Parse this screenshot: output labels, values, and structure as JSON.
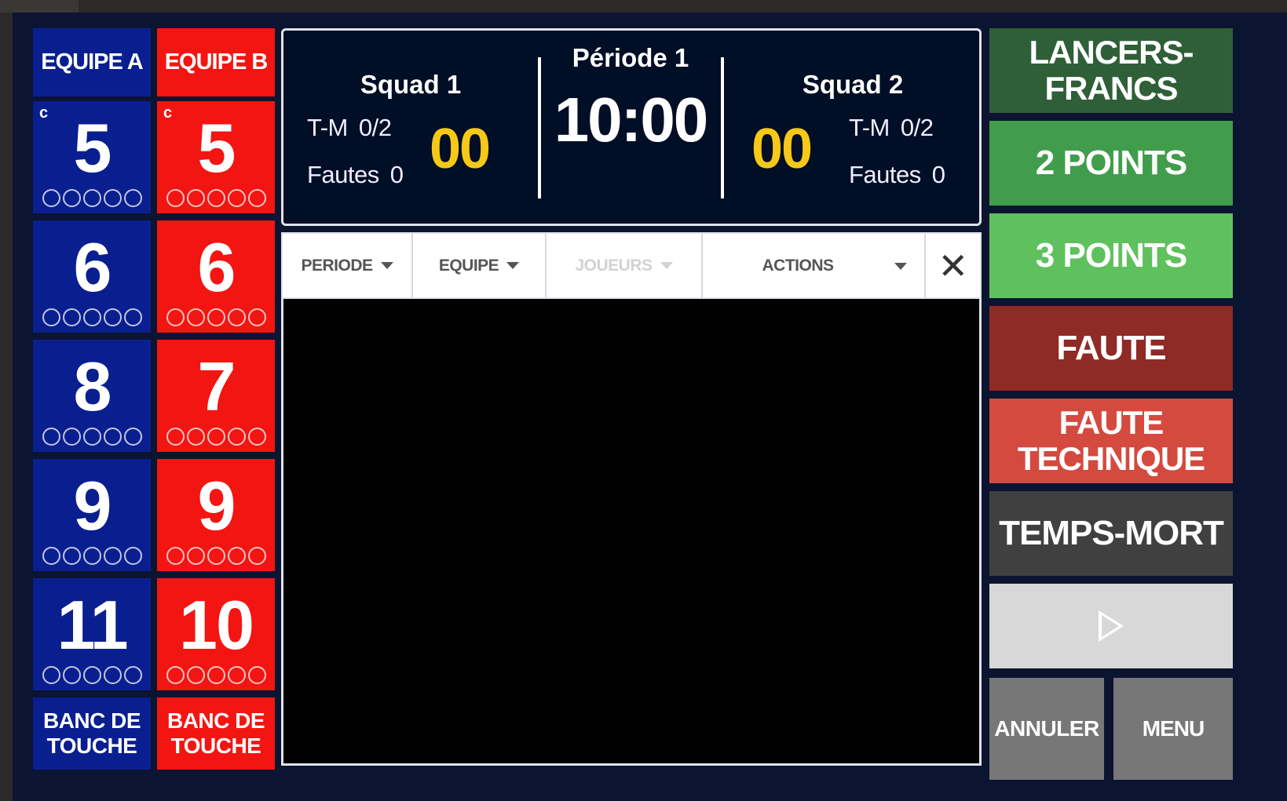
{
  "team_a": {
    "header": "EQUIPE A",
    "color": "#0a1f8f",
    "players": [
      {
        "number": "5",
        "captain": "c"
      },
      {
        "number": "6",
        "captain": ""
      },
      {
        "number": "8",
        "captain": ""
      },
      {
        "number": "9",
        "captain": ""
      },
      {
        "number": "11",
        "captain": ""
      }
    ],
    "bench_label": "BANC DE TOUCHE"
  },
  "team_b": {
    "header": "EQUIPE B",
    "color": "#f31512",
    "players": [
      {
        "number": "5",
        "captain": "c"
      },
      {
        "number": "6",
        "captain": ""
      },
      {
        "number": "7",
        "captain": ""
      },
      {
        "number": "9",
        "captain": ""
      },
      {
        "number": "10",
        "captain": ""
      }
    ],
    "bench_label": "BANC DE TOUCHE"
  },
  "scoreboard": {
    "period": "Période 1",
    "clock": "10:00",
    "home": {
      "name": "Squad 1",
      "timeouts_label": "T-M",
      "timeouts": "0/2",
      "fouls_label": "Fautes",
      "fouls": "0",
      "score": "00"
    },
    "away": {
      "name": "Squad 2",
      "timeouts_label": "T-M",
      "timeouts": "0/2",
      "fouls_label": "Fautes",
      "fouls": "0",
      "score": "00"
    }
  },
  "filters": {
    "periode": "PERIODE",
    "equipe": "EQUIPE",
    "joueurs": "JOUEURS",
    "actions": "ACTIONS",
    "close": "✕"
  },
  "actions": {
    "lancers_francs": "LANCERS-FRANCS",
    "two_points": "2 POINTS",
    "three_points": "3 POINTS",
    "faute": "FAUTE",
    "faute_technique": "FAUTE TECHNIQUE",
    "temps_mort": "TEMPS-MORT",
    "play_icon": "play-icon",
    "annuler": "ANNULER",
    "menu": "MENU"
  },
  "colors": {
    "score": "#f6c818",
    "lancers": "#2f5f37",
    "two_points": "#419d4c",
    "three_points": "#5ec15d",
    "faute": "#8f2a24",
    "faute_technique": "#d44a3f",
    "temps_mort": "#404040"
  }
}
